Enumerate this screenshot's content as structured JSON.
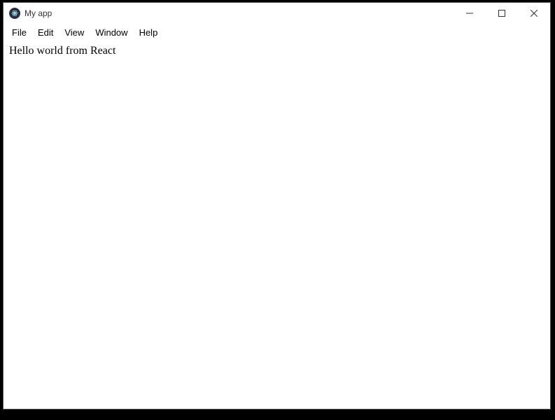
{
  "window": {
    "title": "My app"
  },
  "menubar": {
    "items": [
      {
        "label": "File"
      },
      {
        "label": "Edit"
      },
      {
        "label": "View"
      },
      {
        "label": "Window"
      },
      {
        "label": "Help"
      }
    ]
  },
  "content": {
    "text": "Hello world from React"
  }
}
